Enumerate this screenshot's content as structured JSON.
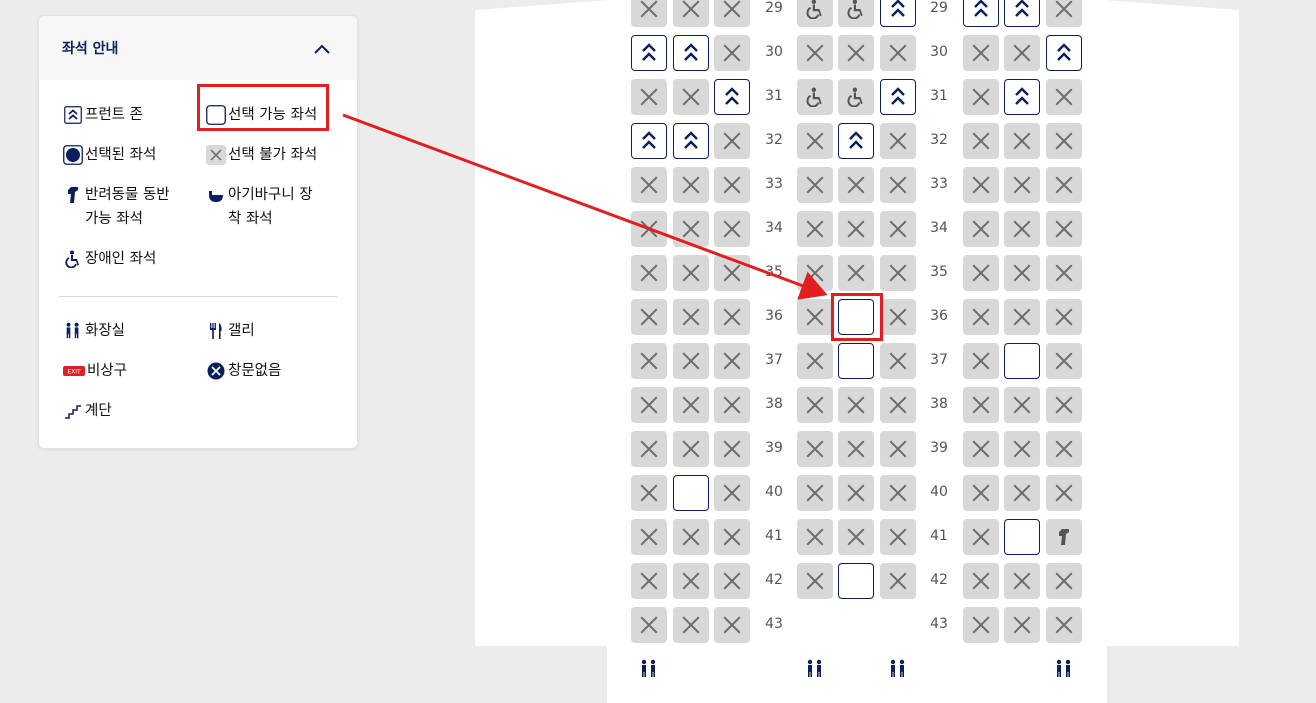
{
  "legend": {
    "title": "좌석 안내",
    "items": {
      "front_zone": "프런트 존",
      "available": "선택 가능 좌석",
      "selected": "선택된 좌석",
      "unavailable": "선택 불가 좌석",
      "pet_line1": "반려동물 동반",
      "pet_line2": "가능 좌석",
      "bassinet_line1": "아기바구니 장",
      "bassinet_line2": "착 좌석",
      "disabled": "장애인 좌석",
      "lavatory": "화장실",
      "galley": "갤리",
      "exit": "비상구",
      "no_window": "창문없음",
      "stairs": "계단"
    },
    "exit_badge": "EXIT"
  },
  "seatmap": {
    "rows": [
      "29",
      "30",
      "31",
      "32",
      "33",
      "34",
      "35",
      "36",
      "37",
      "38",
      "39",
      "40",
      "41",
      "42",
      "43"
    ],
    "seats": {
      "29": [
        "x",
        "x",
        "x",
        "dis",
        "dis",
        "front",
        "front",
        "front",
        "x"
      ],
      "30": [
        "front",
        "front",
        "x",
        "x",
        "x",
        "x",
        "x",
        "x",
        "front"
      ],
      "31": [
        "x",
        "x",
        "front",
        "dis",
        "dis",
        "front",
        "x",
        "front",
        "x"
      ],
      "32": [
        "front",
        "front",
        "x",
        "x",
        "front",
        "x",
        "x",
        "x",
        "x"
      ],
      "33": [
        "x",
        "x",
        "x",
        "x",
        "x",
        "x",
        "x",
        "x",
        "x"
      ],
      "34": [
        "x",
        "x",
        "x",
        "x",
        "x",
        "x",
        "x",
        "x",
        "x"
      ],
      "35": [
        "x",
        "x",
        "x",
        "x",
        "x",
        "x",
        "x",
        "x",
        "x"
      ],
      "36": [
        "x",
        "x",
        "x",
        "x",
        "avail",
        "x",
        "x",
        "x",
        "x"
      ],
      "37": [
        "x",
        "x",
        "x",
        "x",
        "avail",
        "x",
        "x",
        "avail",
        "x"
      ],
      "38": [
        "x",
        "x",
        "x",
        "x",
        "x",
        "x",
        "x",
        "x",
        "x"
      ],
      "39": [
        "x",
        "x",
        "x",
        "x",
        "x",
        "x",
        "x",
        "x",
        "x"
      ],
      "40": [
        "x",
        "avail",
        "x",
        "x",
        "x",
        "x",
        "x",
        "x",
        "x"
      ],
      "41": [
        "x",
        "x",
        "x",
        "x",
        "x",
        "x",
        "x",
        "avail",
        "pet"
      ],
      "42": [
        "x",
        "x",
        "x",
        "x",
        "avail",
        "x",
        "x",
        "x",
        "x"
      ],
      "43": [
        "x",
        "x",
        "x",
        "none",
        "none",
        "none",
        "x",
        "x",
        "x"
      ]
    }
  },
  "colors": {
    "navy": "#0b1f5c",
    "highlight_red": "#e02020",
    "unavailable_gray": "#d8d8d8"
  }
}
